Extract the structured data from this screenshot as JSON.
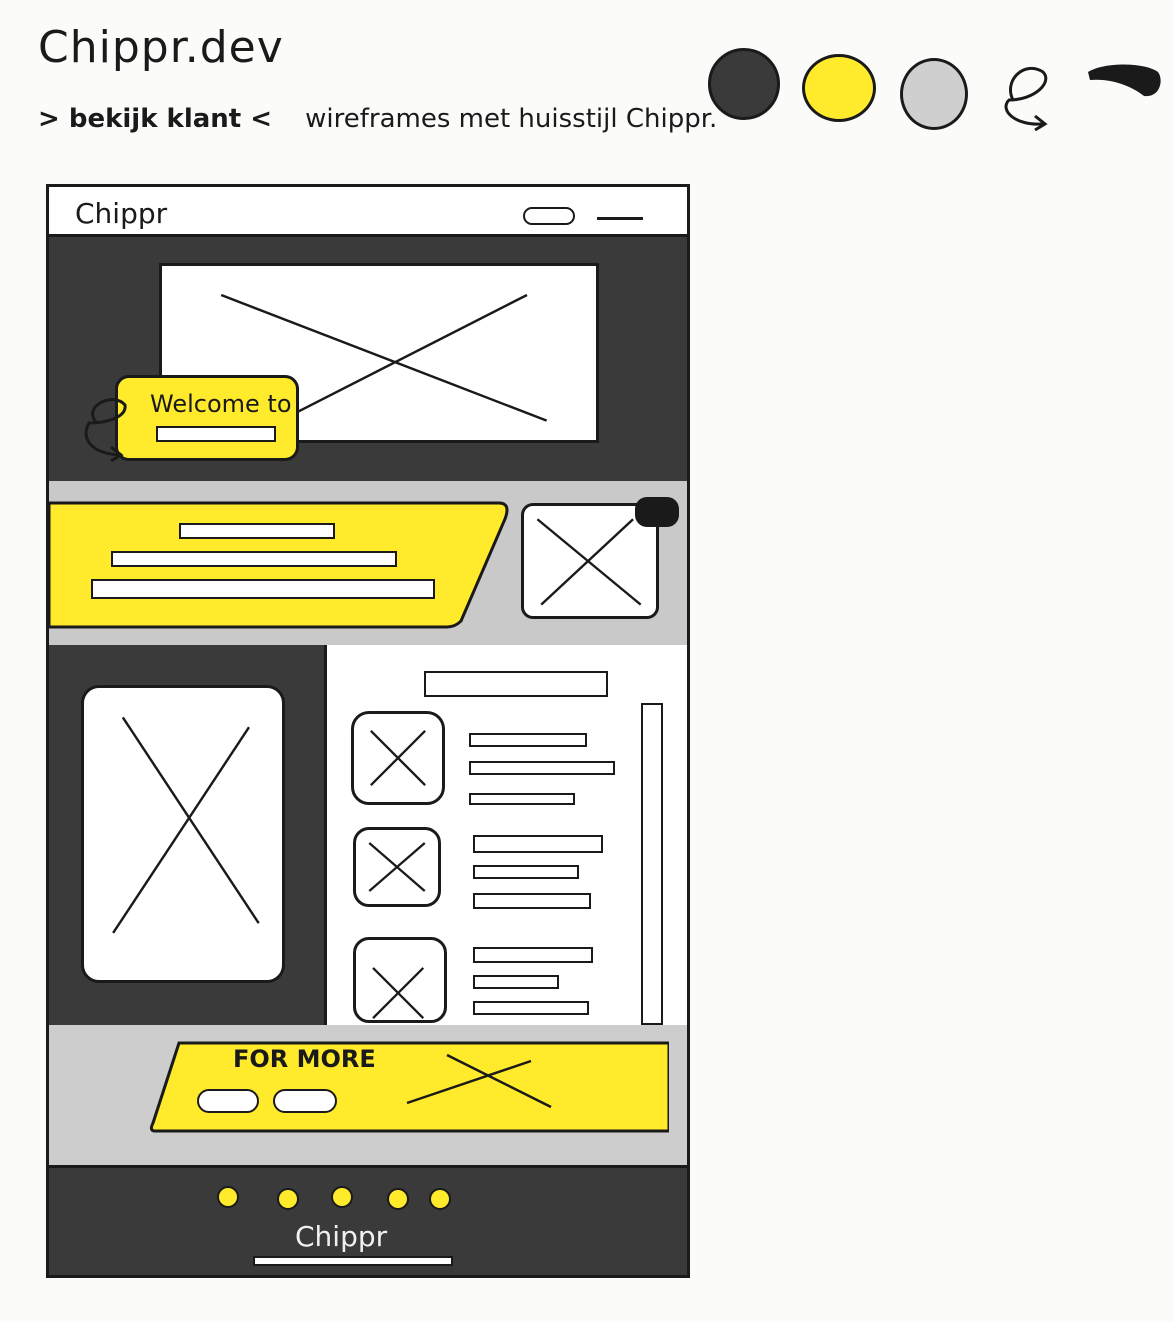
{
  "header": {
    "title": "Chippr.dev",
    "subtitle_link": "> bekijk klant <",
    "subtitle_rest": "wireframes met huisstijl Chippr."
  },
  "palette": {
    "colors": [
      "#3a3a3a",
      "#ffeb2b",
      "#cfcfcf"
    ],
    "extra_icons": [
      "curl-arrow-icon",
      "brush-stroke-icon"
    ]
  },
  "wireframe": {
    "nav": {
      "brand": "Chippr",
      "icons": [
        "pill-icon",
        "menu-line-icon"
      ]
    },
    "hero": {
      "welcome_label": "Welcome to"
    },
    "cta": {
      "label": "FOR MORE"
    },
    "footer": {
      "brand": "Chippr",
      "dot_count": 5
    }
  }
}
